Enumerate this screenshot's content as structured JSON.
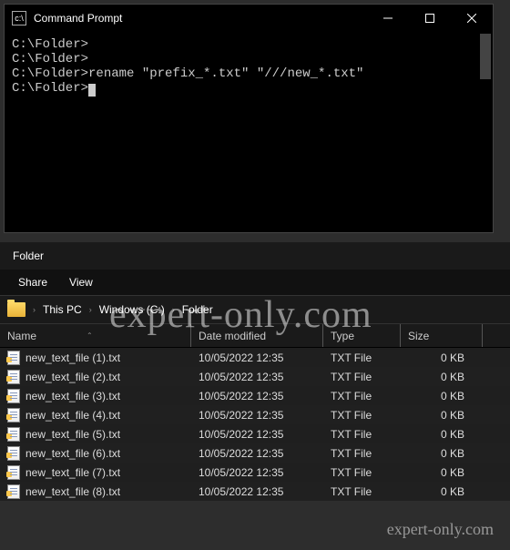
{
  "console": {
    "title": "Command Prompt",
    "lines": [
      "C:\\Folder>",
      "C:\\Folder>",
      "C:\\Folder>rename \"prefix_*.txt\" \"///new_*.txt\"",
      "",
      "C:\\Folder>"
    ]
  },
  "explorer": {
    "title": "Folder",
    "tabs": {
      "share": "Share",
      "view": "View"
    },
    "breadcrumb": [
      "This PC",
      "Windows  (C:)",
      "Folder"
    ],
    "columns": {
      "name": "Name",
      "date": "Date modified",
      "type": "Type",
      "size": "Size"
    },
    "files": [
      {
        "name": "new_text_file (1).txt",
        "date": "10/05/2022 12:35",
        "type": "TXT File",
        "size": "0 KB"
      },
      {
        "name": "new_text_file (2).txt",
        "date": "10/05/2022 12:35",
        "type": "TXT File",
        "size": "0 KB"
      },
      {
        "name": "new_text_file (3).txt",
        "date": "10/05/2022 12:35",
        "type": "TXT File",
        "size": "0 KB"
      },
      {
        "name": "new_text_file (4).txt",
        "date": "10/05/2022 12:35",
        "type": "TXT File",
        "size": "0 KB"
      },
      {
        "name": "new_text_file (5).txt",
        "date": "10/05/2022 12:35",
        "type": "TXT File",
        "size": "0 KB"
      },
      {
        "name": "new_text_file (6).txt",
        "date": "10/05/2022 12:35",
        "type": "TXT File",
        "size": "0 KB"
      },
      {
        "name": "new_text_file (7).txt",
        "date": "10/05/2022 12:35",
        "type": "TXT File",
        "size": "0 KB"
      },
      {
        "name": "new_text_file (8).txt",
        "date": "10/05/2022 12:35",
        "type": "TXT File",
        "size": "0 KB"
      }
    ]
  },
  "watermark": "expert-only.com"
}
